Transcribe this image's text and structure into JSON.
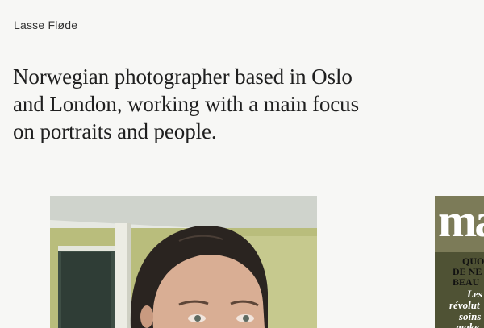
{
  "site": {
    "name": "Lasse Fløde"
  },
  "intro": {
    "lines": [
      "Norwegian photographer based in Oslo",
      "and London, working with a main focus",
      "on portraits and people."
    ]
  },
  "gallery": {
    "magazine": {
      "masthead": "ma",
      "cover_lines": [
        "QUO",
        "DE NE",
        "BEAU",
        "Les",
        "révolut",
        "soins",
        "make"
      ]
    }
  }
}
